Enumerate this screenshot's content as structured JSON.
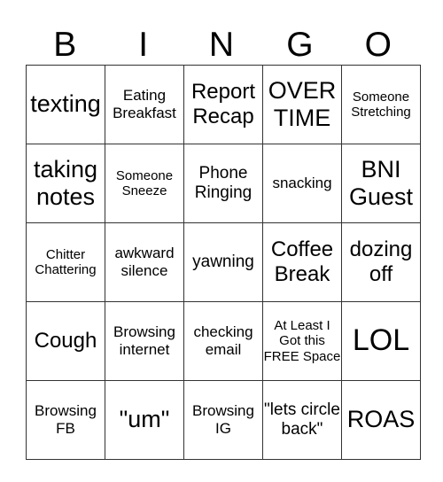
{
  "header": {
    "letters": [
      "B",
      "I",
      "N",
      "G",
      "O"
    ]
  },
  "board": {
    "rows": [
      [
        {
          "text": "texting",
          "size": "l"
        },
        {
          "text": "Eating Breakfast",
          "size": "s"
        },
        {
          "text": "Report Recap",
          "size": "ml"
        },
        {
          "text": "OVER TIME",
          "size": "l"
        },
        {
          "text": "Someone Stretching",
          "size": "xs"
        }
      ],
      [
        {
          "text": "taking notes",
          "size": "l"
        },
        {
          "text": "Someone Sneeze",
          "size": "xs"
        },
        {
          "text": "Phone Ringing",
          "size": "m"
        },
        {
          "text": "snacking",
          "size": "s"
        },
        {
          "text": "BNI Guest",
          "size": "l"
        }
      ],
      [
        {
          "text": "Chitter Chattering",
          "size": "xs"
        },
        {
          "text": "awkward silence",
          "size": "s"
        },
        {
          "text": "yawning",
          "size": "m"
        },
        {
          "text": "Coffee Break",
          "size": "ml"
        },
        {
          "text": "dozing off",
          "size": "ml"
        }
      ],
      [
        {
          "text": "Cough",
          "size": "ml"
        },
        {
          "text": "Browsing internet",
          "size": "s"
        },
        {
          "text": "checking email",
          "size": "s"
        },
        {
          "text": "At Least I Got this FREE Space",
          "size": "xs"
        },
        {
          "text": "LOL",
          "size": "xl"
        }
      ],
      [
        {
          "text": "Browsing FB",
          "size": "s"
        },
        {
          "text": "\"um\"",
          "size": "l"
        },
        {
          "text": "Browsing IG",
          "size": "s"
        },
        {
          "text": "\"lets circle back\"",
          "size": "m"
        },
        {
          "text": "ROAS",
          "size": "l"
        }
      ]
    ]
  }
}
